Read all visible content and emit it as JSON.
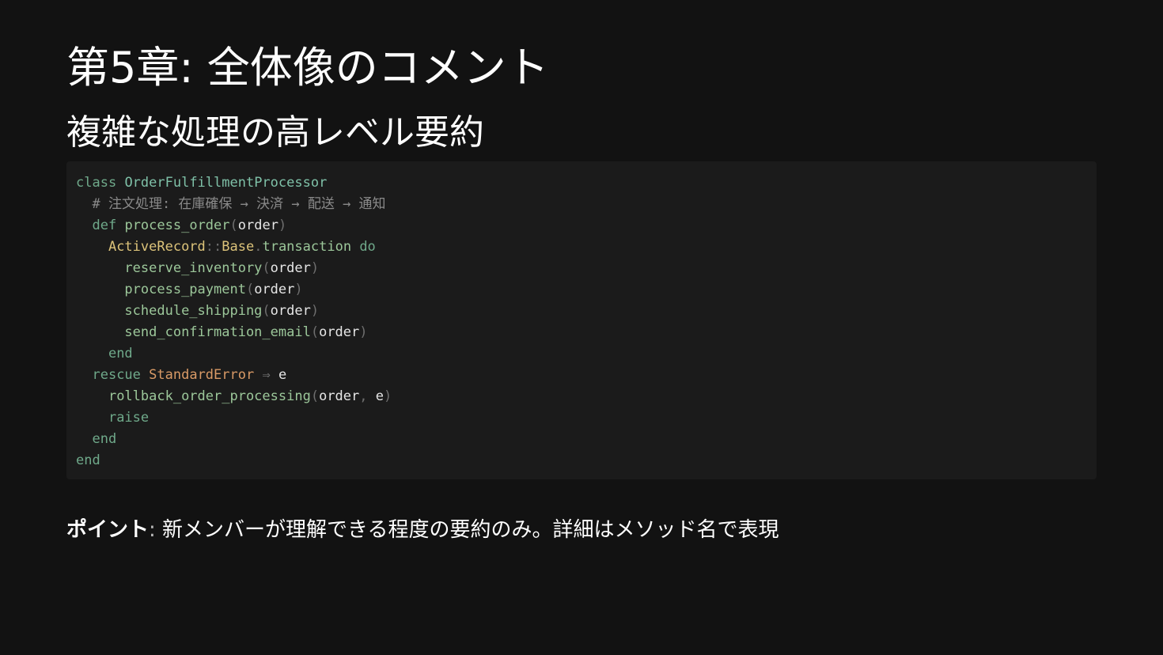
{
  "slide": {
    "title": "第5章: 全体像のコメント",
    "subtitle": "複雑な処理の高レベル要約"
  },
  "code": {
    "language": "ruby",
    "lines": [
      [
        {
          "t": "class",
          "k": "kw"
        },
        {
          "t": " ",
          "k": "ws"
        },
        {
          "t": "OrderFulfillmentProcessor",
          "k": "cls"
        }
      ],
      [
        {
          "t": "  ",
          "k": "ws"
        },
        {
          "t": "# 注文処理: 在庫確保 → 決済 → 配送 → 通知",
          "k": "cmt"
        }
      ],
      [
        {
          "t": "  ",
          "k": "ws"
        },
        {
          "t": "def",
          "k": "kw"
        },
        {
          "t": " ",
          "k": "ws"
        },
        {
          "t": "process_order",
          "k": "fn"
        },
        {
          "t": "(",
          "k": "punc"
        },
        {
          "t": "order",
          "k": "id"
        },
        {
          "t": ")",
          "k": "punc"
        }
      ],
      [
        {
          "t": "    ",
          "k": "ws"
        },
        {
          "t": "ActiveRecord",
          "k": "const"
        },
        {
          "t": "::",
          "k": "punc"
        },
        {
          "t": "Base",
          "k": "const"
        },
        {
          "t": ".",
          "k": "punc"
        },
        {
          "t": "transaction",
          "k": "fn"
        },
        {
          "t": " ",
          "k": "ws"
        },
        {
          "t": "do",
          "k": "kw"
        }
      ],
      [
        {
          "t": "      ",
          "k": "ws"
        },
        {
          "t": "reserve_inventory",
          "k": "fn"
        },
        {
          "t": "(",
          "k": "punc"
        },
        {
          "t": "order",
          "k": "id"
        },
        {
          "t": ")",
          "k": "punc"
        }
      ],
      [
        {
          "t": "      ",
          "k": "ws"
        },
        {
          "t": "process_payment",
          "k": "fn"
        },
        {
          "t": "(",
          "k": "punc"
        },
        {
          "t": "order",
          "k": "id"
        },
        {
          "t": ")",
          "k": "punc"
        }
      ],
      [
        {
          "t": "      ",
          "k": "ws"
        },
        {
          "t": "schedule_shipping",
          "k": "fn"
        },
        {
          "t": "(",
          "k": "punc"
        },
        {
          "t": "order",
          "k": "id"
        },
        {
          "t": ")",
          "k": "punc"
        }
      ],
      [
        {
          "t": "      ",
          "k": "ws"
        },
        {
          "t": "send_confirmation_email",
          "k": "fn"
        },
        {
          "t": "(",
          "k": "punc"
        },
        {
          "t": "order",
          "k": "id"
        },
        {
          "t": ")",
          "k": "punc"
        }
      ],
      [
        {
          "t": "    ",
          "k": "ws"
        },
        {
          "t": "end",
          "k": "kw"
        }
      ],
      [
        {
          "t": "  ",
          "k": "ws"
        },
        {
          "t": "rescue",
          "k": "kw"
        },
        {
          "t": " ",
          "k": "ws"
        },
        {
          "t": "StandardError",
          "k": "err"
        },
        {
          "t": " ",
          "k": "ws"
        },
        {
          "t": "⇒",
          "k": "punc"
        },
        {
          "t": " ",
          "k": "ws"
        },
        {
          "t": "e",
          "k": "id"
        }
      ],
      [
        {
          "t": "    ",
          "k": "ws"
        },
        {
          "t": "rollback_order_processing",
          "k": "fn"
        },
        {
          "t": "(",
          "k": "punc"
        },
        {
          "t": "order",
          "k": "id"
        },
        {
          "t": ",",
          "k": "punc"
        },
        {
          "t": " ",
          "k": "ws"
        },
        {
          "t": "e",
          "k": "id"
        },
        {
          "t": ")",
          "k": "punc"
        }
      ],
      [
        {
          "t": "    ",
          "k": "ws"
        },
        {
          "t": "raise",
          "k": "kw"
        }
      ],
      [
        {
          "t": "  ",
          "k": "ws"
        },
        {
          "t": "end",
          "k": "kw"
        }
      ],
      [
        {
          "t": "end",
          "k": "kw"
        }
      ]
    ]
  },
  "point": {
    "label": "ポイント",
    "separator": ": ",
    "text": "新メンバーが理解できる程度の要約のみ。詳細はメソッド名で表現"
  },
  "colors": {
    "background": "#121212",
    "code_background": "#1b1b1b",
    "keyword": "#6fa98a",
    "class_name": "#7fc1a8",
    "constant": "#dcc37a",
    "error_class": "#d99a66",
    "method": "#9cc79a",
    "identifier": "#e6e6e6",
    "punctuation": "#6e6e6e",
    "comment": "#8a8a8a"
  }
}
